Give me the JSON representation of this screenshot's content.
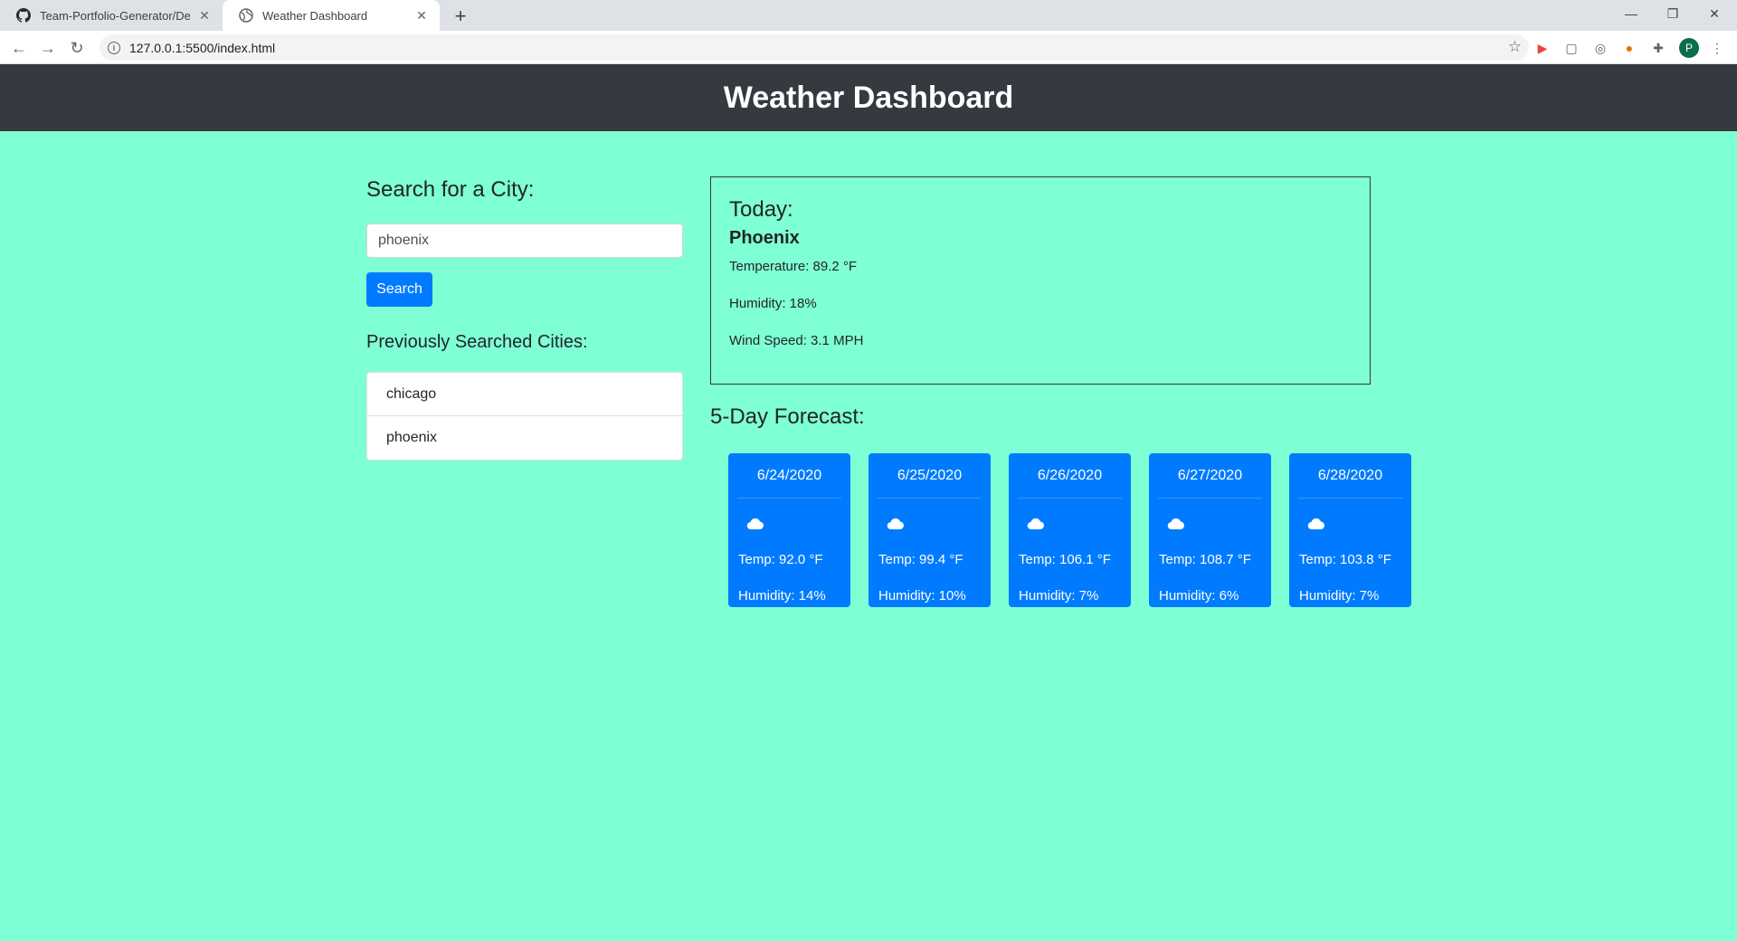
{
  "browser": {
    "tabs": [
      {
        "label": "Team-Portfolio-Generator/Develo",
        "icon": "github-icon",
        "active": false
      },
      {
        "label": "Weather Dashboard",
        "icon": "globe-icon",
        "active": true
      }
    ],
    "url": "127.0.0.1:5500/index.html",
    "profile_initial": "P"
  },
  "header": {
    "title": "Weather Dashboard"
  },
  "search": {
    "title": "Search for a City:",
    "value": "phoenix",
    "button_label": "Search"
  },
  "previous": {
    "title": "Previously Searched Cities:",
    "cities": [
      "chicago",
      "phoenix"
    ]
  },
  "today": {
    "title": "Today:",
    "city": "Phoenix",
    "temperature": "Temperature: 89.2 °F",
    "humidity": "Humidity: 18%",
    "wind": "Wind Speed: 3.1 MPH"
  },
  "forecast": {
    "title": "5-Day Forecast:",
    "days": [
      {
        "date": "6/24/2020",
        "icon": "cloud-icon",
        "temp": "Temp: 92.0 °F",
        "humidity": "Humidity: 14%"
      },
      {
        "date": "6/25/2020",
        "icon": "cloud-icon",
        "temp": "Temp: 99.4 °F",
        "humidity": "Humidity: 10%"
      },
      {
        "date": "6/26/2020",
        "icon": "cloud-icon",
        "temp": "Temp: 106.1 °F",
        "humidity": "Humidity: 7%"
      },
      {
        "date": "6/27/2020",
        "icon": "cloud-icon",
        "temp": "Temp: 108.7 °F",
        "humidity": "Humidity: 6%"
      },
      {
        "date": "6/28/2020",
        "icon": "cloud-icon",
        "temp": "Temp: 103.8 °F",
        "humidity": "Humidity: 7%"
      }
    ]
  },
  "colors": {
    "page_background": "#7fffd4",
    "header_background": "#343a40",
    "primary": "#007bff"
  }
}
